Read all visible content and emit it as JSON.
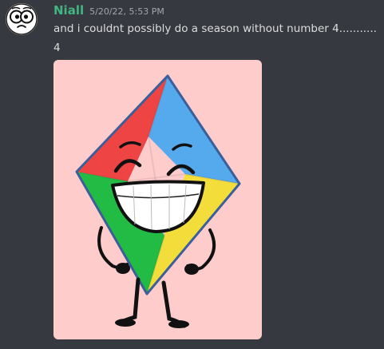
{
  "message": {
    "author": "Niall",
    "timestamp": "5/20/22, 5:53 PM",
    "lines": [
      "and i couldnt possibly do a season without number 4...........",
      "4"
    ]
  },
  "avatar": {
    "icon": "cartoon-face-avatar-icon"
  },
  "attachment": {
    "icon": "kite-character-image",
    "background": "#ffcccc"
  },
  "colors": {
    "background": "#36393f",
    "username": "#43b581",
    "text": "#dcddde",
    "timestamp": "#a3a6aa",
    "kite_red": "#ee4444",
    "kite_blue": "#55aaee",
    "kite_green": "#22bb44",
    "kite_yellow": "#f3dd3b",
    "kite_outline": "#3a5f9a"
  }
}
